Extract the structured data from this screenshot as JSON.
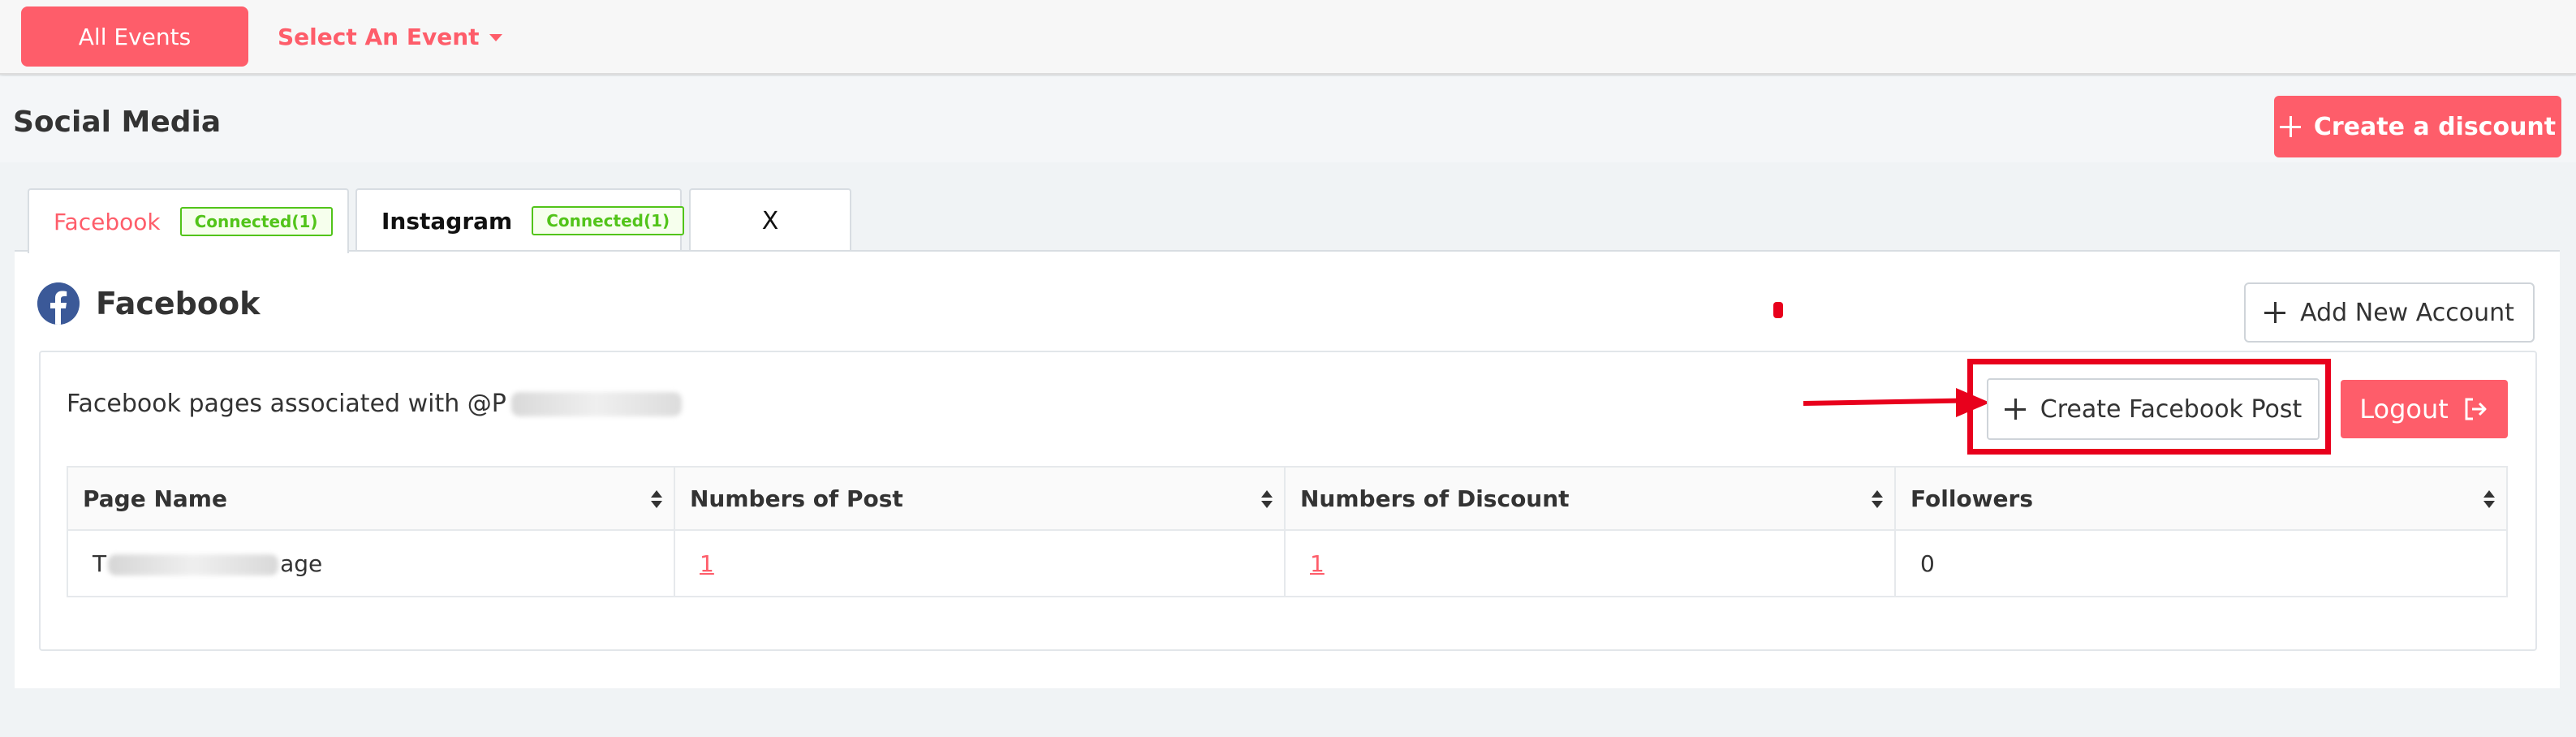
{
  "topbar": {
    "all_events_label": "All Events",
    "select_event_label": "Select An Event"
  },
  "page": {
    "title": "Social Media",
    "create_discount_label": "Create a discount"
  },
  "tabs": [
    {
      "label": "Facebook",
      "badge": "Connected(1)",
      "active": true
    },
    {
      "label": "Instagram",
      "badge": "Connected(1)",
      "active": false
    },
    {
      "label": "X",
      "badge": "",
      "active": false
    }
  ],
  "facebook": {
    "heading": "Facebook",
    "add_account_label": "Add New Account",
    "pages_text": "Facebook pages associated with @P",
    "create_post_label": "Create Facebook Post",
    "logout_label": "Logout"
  },
  "table": {
    "headers": [
      "Page Name",
      "Numbers of Post",
      "Numbers of Discount",
      "Followers"
    ],
    "rows": [
      {
        "page_name_start": "T",
        "page_name_end": "age",
        "posts": "1",
        "discounts": "1",
        "followers": "0"
      }
    ]
  },
  "colors": {
    "accent": "#fe5d6a",
    "annotation_red": "#e8001c",
    "facebook_blue": "#3b5998",
    "connected_green": "#52c41a"
  },
  "icons": {
    "facebook": "facebook-logo-icon",
    "plus": "plus-icon",
    "logout": "logout-icon",
    "sort": "sort-icon",
    "caret": "caret-down-icon"
  }
}
